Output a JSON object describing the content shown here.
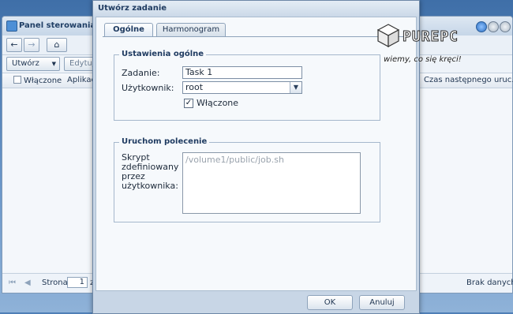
{
  "background_window": {
    "title": "Panel sterowania - T",
    "toolbar": {
      "create_label": "Utwórz",
      "edit_label": "Edytuj"
    },
    "columns": [
      {
        "label": "Włączone"
      },
      {
        "label": "Aplikacja"
      },
      {
        "label": "Czas następnego uruc..."
      }
    ],
    "pager": {
      "page_label": "Strona",
      "page_value": "1",
      "page_suffix": "z",
      "status": "Brak danych"
    }
  },
  "dialog": {
    "title": "Utwórz zadanie",
    "tabs": [
      {
        "label": "Ogólne",
        "active": true
      },
      {
        "label": "Harmonogram",
        "active": false
      }
    ],
    "general_settings": {
      "legend": "Ustawienia ogólne",
      "task_label": "Zadanie:",
      "task_value": "Task 1",
      "user_label": "Użytkownik:",
      "user_value": "root",
      "enabled_label": "Włączone",
      "enabled_checked": true
    },
    "run_command": {
      "legend": "Uruchom polecenie",
      "script_label_lines": [
        "Skrypt",
        "zdefiniowany",
        "przez",
        "użytkownika:"
      ],
      "script_placeholder": "/volume1/public/job.sh"
    },
    "buttons": {
      "ok_label": "OK",
      "cancel_label": "Anuluj"
    }
  },
  "watermark": {
    "brand": "PUREPC",
    "slogan": "wiemy, co się kręci!"
  },
  "colors": {
    "accent": "#2d6fc2",
    "window_bg": "#f6f9fc",
    "desktop": "#4f7fb6"
  }
}
